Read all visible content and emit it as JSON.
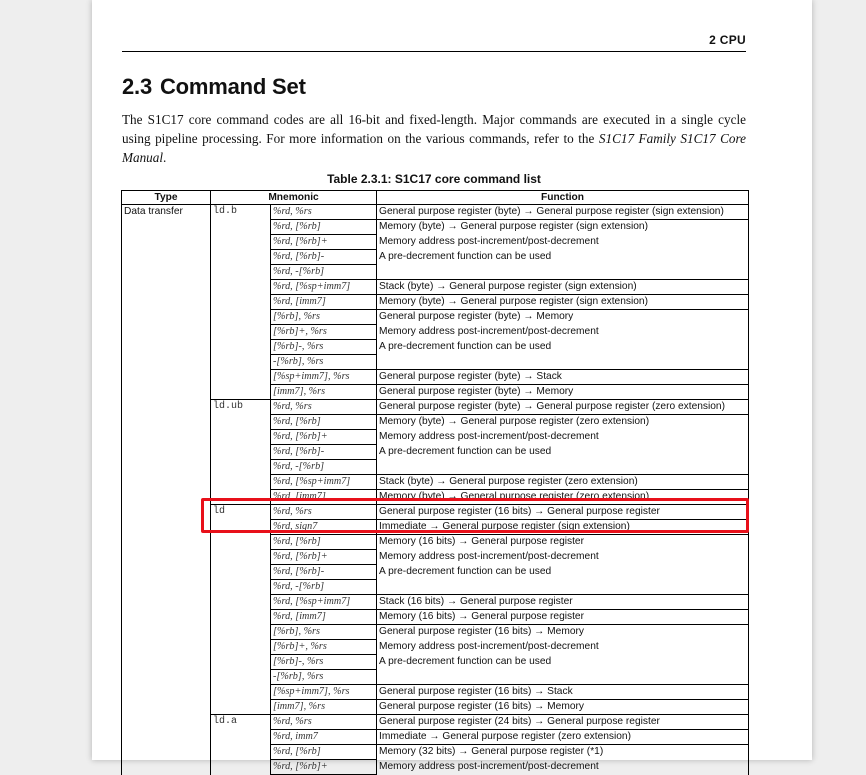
{
  "header": {
    "chapter": "2 CPU"
  },
  "section": {
    "number": "2.3",
    "title": "Command Set"
  },
  "intro": {
    "text": "The S1C17 core command codes are all 16-bit and fixed-length. Major commands are executed in a single cycle using pipeline processing. For more information on the various commands, refer to the ",
    "manual_ref": "S1C17 Family S1C17 Core Manual",
    "end": "."
  },
  "table": {
    "caption": "Table 2.3.1: S1C17 core command list",
    "headers": {
      "type": "Type",
      "mnemonic": "Mnemonic",
      "function": "Function"
    },
    "type_label": "Data transfer",
    "rows": [
      {
        "m": "ld.b",
        "o": "%rd, %rs",
        "f": "General purpose register (byte) → General purpose register (sign extension)",
        "ft": 1,
        "fb": 1
      },
      {
        "m": "",
        "o": "%rd, [%rb]",
        "f": "Memory (byte) → General purpose register (sign extension)",
        "ft": 1,
        "fb": 0
      },
      {
        "m": "",
        "o": "%rd, [%rb]+",
        "f": "Memory address post-increment/post-decrement",
        "ft": 0,
        "fb": 0
      },
      {
        "m": "",
        "o": "%rd, [%rb]-",
        "f": "A pre-decrement function can be used",
        "ft": 0,
        "fb": 0
      },
      {
        "m": "",
        "o": "%rd, -[%rb]",
        "f": "",
        "ft": 0,
        "fb": 1
      },
      {
        "m": "",
        "o": "%rd, [%sp+imm7]",
        "f": "Stack (byte) → General purpose register (sign extension)",
        "ft": 1,
        "fb": 1
      },
      {
        "m": "",
        "o": "%rd, [imm7]",
        "f": "Memory (byte) → General purpose register (sign extension)",
        "ft": 1,
        "fb": 1
      },
      {
        "m": "",
        "o": "[%rb], %rs",
        "f": "General purpose register (byte) → Memory",
        "ft": 1,
        "fb": 0
      },
      {
        "m": "",
        "o": "[%rb]+, %rs",
        "f": "Memory address post-increment/post-decrement",
        "ft": 0,
        "fb": 0
      },
      {
        "m": "",
        "o": "[%rb]-, %rs",
        "f": "A pre-decrement function can be used",
        "ft": 0,
        "fb": 0
      },
      {
        "m": "",
        "o": "-[%rb], %rs",
        "f": "",
        "ft": 0,
        "fb": 1
      },
      {
        "m": "",
        "o": "[%sp+imm7], %rs",
        "f": "General purpose register (byte) → Stack",
        "ft": 1,
        "fb": 1
      },
      {
        "m": "",
        "o": "[imm7], %rs",
        "f": "General purpose register (byte) → Memory",
        "ft": 1,
        "fb": 1
      },
      {
        "m": "ld.ub",
        "o": "%rd, %rs",
        "f": "General purpose register (byte) → General purpose register (zero extension)",
        "ft": 1,
        "fb": 1
      },
      {
        "m": "",
        "o": "%rd, [%rb]",
        "f": "Memory (byte) → General purpose register (zero extension)",
        "ft": 1,
        "fb": 0
      },
      {
        "m": "",
        "o": "%rd, [%rb]+",
        "f": "Memory address post-increment/post-decrement",
        "ft": 0,
        "fb": 0
      },
      {
        "m": "",
        "o": "%rd, [%rb]-",
        "f": "A pre-decrement function can be used",
        "ft": 0,
        "fb": 0
      },
      {
        "m": "",
        "o": "%rd, -[%rb]",
        "f": "",
        "ft": 0,
        "fb": 1
      },
      {
        "m": "",
        "o": "%rd, [%sp+imm7]",
        "f": "Stack (byte) → General purpose register (zero extension)",
        "ft": 1,
        "fb": 1
      },
      {
        "m": "",
        "o": "%rd, [imm7]",
        "f": "Memory (byte) → General purpose register (zero extension)",
        "ft": 1,
        "fb": 1
      },
      {
        "m": "ld",
        "o": "%rd, %rs",
        "f": "General purpose register (16 bits) → General purpose register",
        "ft": 1,
        "fb": 1
      },
      {
        "m": "",
        "o": "%rd, sign7",
        "f": "Immediate → General purpose register (sign extension)",
        "ft": 1,
        "fb": 1
      },
      {
        "m": "",
        "o": "%rd, [%rb]",
        "f": "Memory (16 bits) → General purpose register",
        "ft": 1,
        "fb": 0
      },
      {
        "m": "",
        "o": "%rd, [%rb]+",
        "f": "Memory address post-increment/post-decrement",
        "ft": 0,
        "fb": 0
      },
      {
        "m": "",
        "o": "%rd, [%rb]-",
        "f": "A pre-decrement function can be used",
        "ft": 0,
        "fb": 0
      },
      {
        "m": "",
        "o": "%rd, -[%rb]",
        "f": "",
        "ft": 0,
        "fb": 1
      },
      {
        "m": "",
        "o": "%rd, [%sp+imm7]",
        "f": "Stack (16 bits) → General purpose register",
        "ft": 1,
        "fb": 1
      },
      {
        "m": "",
        "o": "%rd, [imm7]",
        "f": "Memory (16 bits) → General purpose register",
        "ft": 1,
        "fb": 1
      },
      {
        "m": "",
        "o": "[%rb], %rs",
        "f": "General purpose register (16 bits) → Memory",
        "ft": 1,
        "fb": 0
      },
      {
        "m": "",
        "o": "[%rb]+, %rs",
        "f": "Memory address post-increment/post-decrement",
        "ft": 0,
        "fb": 0
      },
      {
        "m": "",
        "o": "[%rb]-, %rs",
        "f": "A pre-decrement function can be used",
        "ft": 0,
        "fb": 0
      },
      {
        "m": "",
        "o": "-[%rb], %rs",
        "f": "",
        "ft": 0,
        "fb": 1
      },
      {
        "m": "",
        "o": "[%sp+imm7], %rs",
        "f": "General purpose register (16 bits) → Stack",
        "ft": 1,
        "fb": 1
      },
      {
        "m": "",
        "o": "[imm7], %rs",
        "f": "General purpose register (16 bits) → Memory",
        "ft": 1,
        "fb": 1
      },
      {
        "m": "ld.a",
        "o": "%rd, %rs",
        "f": "General purpose register (24 bits) → General purpose register",
        "ft": 1,
        "fb": 1
      },
      {
        "m": "",
        "o": "%rd, imm7",
        "f": "Immediate → General purpose register (zero extension)",
        "ft": 1,
        "fb": 1
      },
      {
        "m": "",
        "o": "%rd, [%rb]",
        "f": "Memory (32 bits) → General purpose register (*1)",
        "ft": 1,
        "fb": 0
      },
      {
        "m": "",
        "o": "%rd, [%rb]+",
        "f": "Memory address post-increment/post-decrement",
        "ft": 0,
        "fb": 0
      }
    ]
  }
}
